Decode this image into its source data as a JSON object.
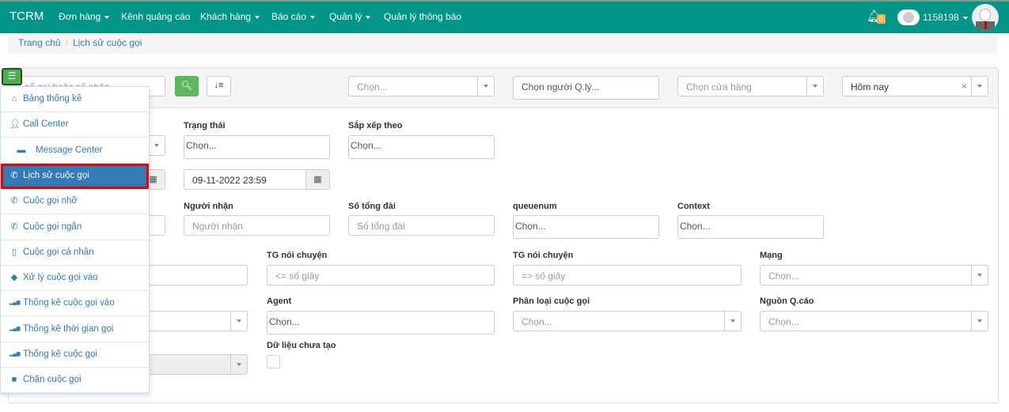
{
  "nav": {
    "brand": "TCRM",
    "items": [
      {
        "label": "Đơn hàng",
        "dropdown": true
      },
      {
        "label": "Kênh quảng cáo",
        "dropdown": false
      },
      {
        "label": "Khách hàng",
        "dropdown": true
      },
      {
        "label": "Báo cáo",
        "dropdown": true
      },
      {
        "label": "Quản lý",
        "dropdown": true
      },
      {
        "label": "Quản lý thông báo",
        "dropdown": false
      }
    ],
    "notification_count": "0",
    "user_id": "1158198"
  },
  "breadcrumb": {
    "home": "Trang chủ",
    "current": "Lịch sử cuộc gọi"
  },
  "toolbar": {
    "search_placeholder": "số gọi hoặc số nhận",
    "select1": "Chọn...",
    "manager": "Chọn người Q.lý...",
    "store": "Chọn cửa hàng",
    "date_range": "Hôm nay",
    "clear": "×"
  },
  "filters": {
    "status": {
      "label": "Trạng thái",
      "placeholder": "Chọn..."
    },
    "sort": {
      "label": "Sắp xếp theo",
      "placeholder": "Chọn..."
    },
    "date_to": "09-11-2022 23:59",
    "receiver": {
      "label": "Người nhận",
      "placeholder": "Người nhận"
    },
    "switchboard": {
      "label": "Số tổng đài",
      "placeholder": "Số tổng đài"
    },
    "queuenum": {
      "label": "queuenum",
      "placeholder": "Chọn..."
    },
    "context": {
      "label": "Context",
      "placeholder": "Chọn..."
    },
    "talk_min": {
      "label": "TG nói chuyện",
      "placeholder": "<= số giây"
    },
    "talk_max": {
      "label": "TG nói chuyện",
      "placeholder": "=> số giây"
    },
    "network": {
      "label": "Mạng",
      "placeholder": "Chọn..."
    },
    "agent": {
      "label": "Agent",
      "placeholder": "Chọn..."
    },
    "call_type": {
      "label": "Phân loại cuộc gọi",
      "placeholder": "Chọn..."
    },
    "ad_source": {
      "label": "Nguồn Q.cáo",
      "placeholder": "Chọn..."
    },
    "no_data": {
      "label": "Dữ liệu chưa tạo",
      "checked": false
    }
  },
  "menu": {
    "items": [
      {
        "label": "Bảng thống kê",
        "icon": "home-icon"
      },
      {
        "label": "Call Center",
        "icon": "user-icon"
      },
      {
        "label": "Message Center",
        "icon": "comment-icon"
      },
      {
        "label": "Lịch sử cuộc gọi",
        "icon": "phone-icon",
        "active": true
      },
      {
        "label": "Cuộc gọi nhỡ",
        "icon": "phone-icon"
      },
      {
        "label": "Cuộc gọi ngắn",
        "icon": "phone-icon"
      },
      {
        "label": "Cuộc gọi cá nhân",
        "icon": "mobile-icon"
      },
      {
        "label": "Xử lý cuộc gọi vào",
        "icon": "tags-icon"
      },
      {
        "label": "Thống kê cuộc gọi vào",
        "icon": "signal-icon"
      },
      {
        "label": "Thống kê thời gian gọi",
        "icon": "signal-icon"
      },
      {
        "label": "Thống kê cuộc gọi",
        "icon": "signal-icon"
      },
      {
        "label": "Chặn cuộc gọi",
        "icon": "book-icon"
      }
    ]
  },
  "colors": {
    "navbar": "#009687",
    "primary": "#337ab7",
    "success": "#5cb85c",
    "badge": "#f0ad4e"
  }
}
